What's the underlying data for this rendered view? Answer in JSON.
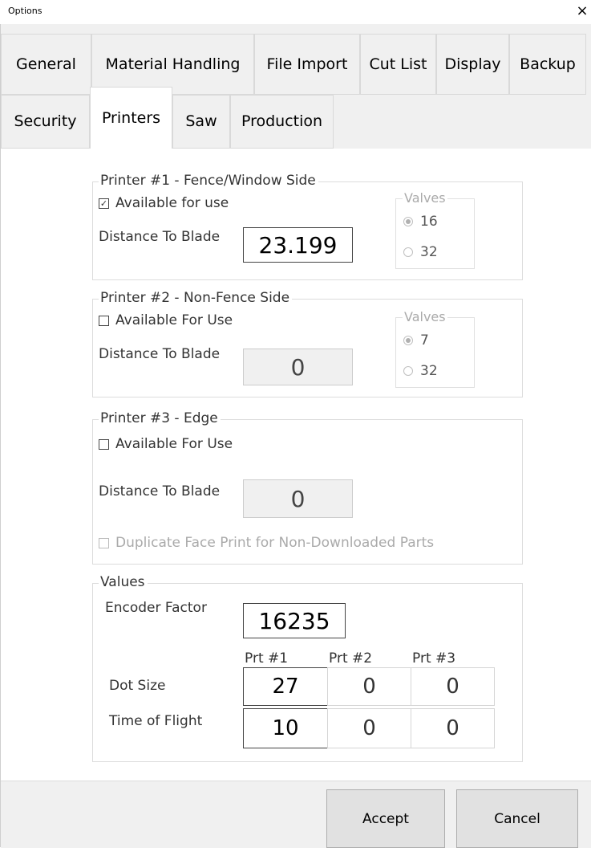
{
  "window": {
    "title": "Options",
    "close_glyph": "×"
  },
  "tabs_row1": [
    "General",
    "Material Handling",
    "File Import",
    "Cut List",
    "Display",
    "Backup"
  ],
  "tabs_row2": [
    "Security",
    "Printers",
    "Saw",
    "Production"
  ],
  "active_tab": "Printers",
  "printer1": {
    "title": "Printer #1  -  Fence/Window Side",
    "available_label": "Available for use",
    "available_checked": true,
    "distance_label": "Distance To Blade",
    "distance_value": "23.199",
    "valves_title": "Valves",
    "valve_options": [
      "16",
      "32"
    ],
    "valve_selected": "16"
  },
  "printer2": {
    "title": "Printer #2  -  Non-Fence Side",
    "available_label": "Available For Use",
    "available_checked": false,
    "distance_label": "Distance To Blade",
    "distance_value": "0",
    "valves_title": "Valves",
    "valve_options": [
      "7",
      "32"
    ],
    "valve_selected": "7"
  },
  "printer3": {
    "title": "Printer #3  -  Edge",
    "available_label": "Available For Use",
    "available_checked": false,
    "distance_label": "Distance To Blade",
    "distance_value": "0",
    "duplicate_label": "Duplicate Face Print for Non-Downloaded Parts"
  },
  "values": {
    "title": "Values",
    "encoder_label": "Encoder Factor",
    "encoder_value": "16235",
    "col_headers": [
      "Prt #1",
      "Prt #2",
      "Prt #3"
    ],
    "dot_size_label": "Dot Size",
    "dot_size": [
      "27",
      "0",
      "0"
    ],
    "tof_label": "Time of Flight",
    "tof": [
      "10",
      "0",
      "0"
    ]
  },
  "buttons": {
    "accept": "Accept",
    "cancel": "Cancel"
  },
  "icons": {
    "check": "✓"
  }
}
